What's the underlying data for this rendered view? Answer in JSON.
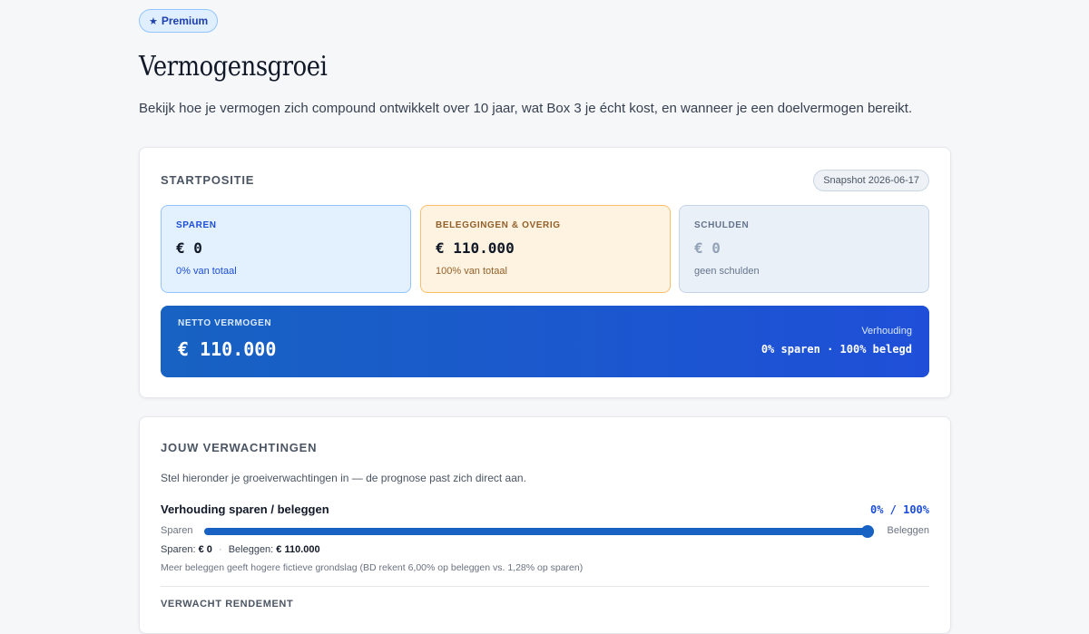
{
  "badge": {
    "icon": "star-icon",
    "label": "Premium"
  },
  "page": {
    "title": "Vermogensgroei",
    "intro": "Bekijk hoe je vermogen zich compound ontwikkelt over 10 jaar, wat Box 3 je écht kost, en wanneer je een doelvermogen bereikt."
  },
  "startpositie": {
    "title": "STARTPOSITIE",
    "snapshot": "Snapshot 2026-06-17",
    "tiles": {
      "sparen": {
        "label": "SPAREN",
        "value": "€ 0",
        "sub": "0% van totaal"
      },
      "beleggingen": {
        "label": "BELEGGINGEN & OVERIG",
        "value": "€ 110.000",
        "sub": "100% van totaal"
      },
      "schulden": {
        "label": "SCHULDEN",
        "value": "€ 0",
        "sub": "geen schulden"
      }
    },
    "netto": {
      "label": "NETTO VERMOGEN",
      "value": "€ 110.000",
      "ratio_label": "Verhouding",
      "ratio_value": "0% sparen · 100% belegd"
    }
  },
  "verwachtingen": {
    "title": "JOUW VERWACHTINGEN",
    "description": "Stel hieronder je groeiverwachtingen in — de prognose past zich direct aan.",
    "ratio": {
      "label": "Verhouding sparen / beleggen",
      "value": "0% / 100%",
      "left_label": "Sparen",
      "right_label": "Beleggen",
      "beleggen_fraction": 1.0
    },
    "amounts": {
      "sparen_label": "Sparen:",
      "sparen_value": "€ 0",
      "separator": "·",
      "beleggen_label": "Beleggen:",
      "beleggen_value": "€ 110.000"
    },
    "note": "Meer beleggen geeft hogere fictieve grondslag (BD rekent 6,00% op beleggen vs. 1,28% op sparen)",
    "rendement_title": "VERWACHT RENDEMENT"
  },
  "colors": {
    "accent": "#1762c2",
    "accent2": "#1f4fd8"
  }
}
